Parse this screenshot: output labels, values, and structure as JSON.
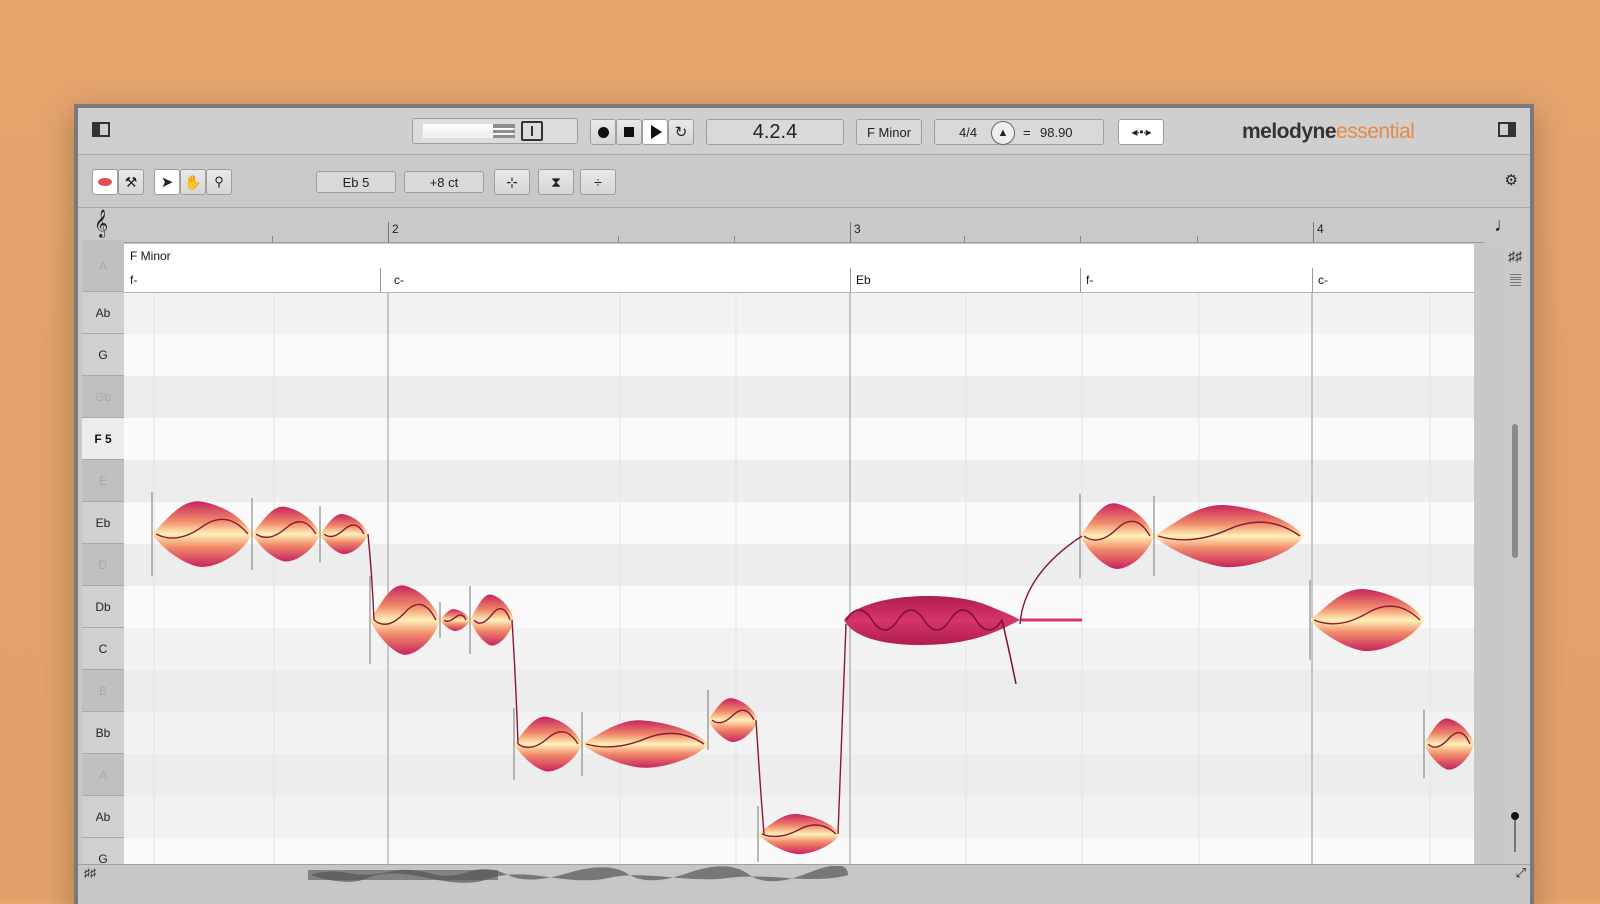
{
  "transport": {
    "position": "4.2.4",
    "key": "F Minor",
    "time_signature": "4/4",
    "tempo_eq": "=",
    "tempo": "98.90"
  },
  "app": {
    "logo_main": "melodyne",
    "logo_edition": "essential"
  },
  "note_tools": {
    "pitch": "Eb 5",
    "cents": "+8 ct"
  },
  "ruler": {
    "bars": [
      "2",
      "3",
      "4"
    ]
  },
  "scale_label": "F Minor",
  "chords": [
    "f-",
    "c-",
    "Eb",
    "f-",
    "c-"
  ],
  "keys": [
    {
      "label": "A",
      "black": true
    },
    {
      "label": "Ab",
      "black": false
    },
    {
      "label": "G",
      "black": false
    },
    {
      "label": "Gb",
      "black": true
    },
    {
      "label": "F 5",
      "black": false,
      "active": true
    },
    {
      "label": "E",
      "black": true
    },
    {
      "label": "Eb",
      "black": false
    },
    {
      "label": "D",
      "black": true
    },
    {
      "label": "Db",
      "black": false
    },
    {
      "label": "C",
      "black": false
    },
    {
      "label": "B",
      "black": true
    },
    {
      "label": "Bb",
      "black": false
    },
    {
      "label": "A",
      "black": true
    },
    {
      "label": "Ab",
      "black": false
    },
    {
      "label": "G",
      "black": false
    }
  ],
  "blob_colors": {
    "outer": "#c8245e",
    "mid": "#f08a6a",
    "inner": "#fff1b8",
    "line": "#8a1838"
  }
}
